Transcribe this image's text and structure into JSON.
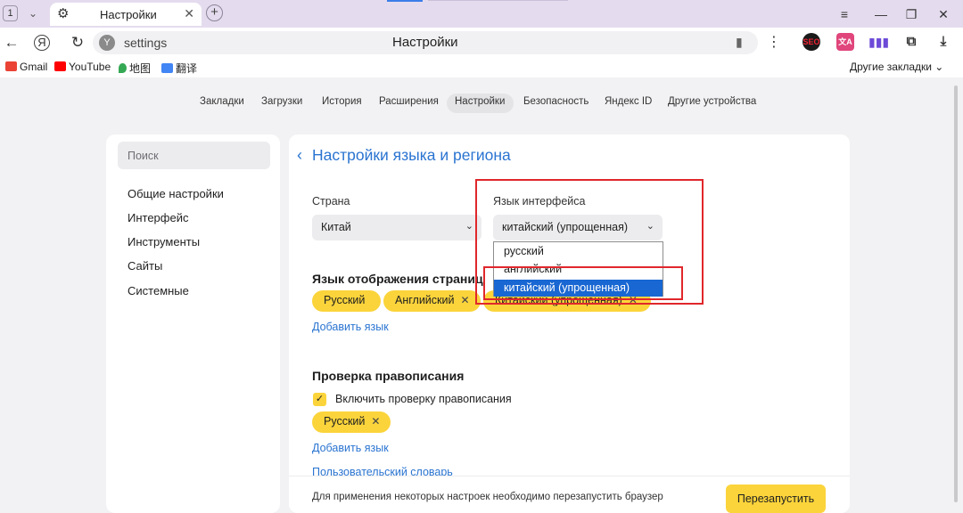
{
  "browser": {
    "tab_count": "1",
    "tab_title": "Настройки",
    "url": "settings",
    "page_title": "Настройки",
    "bookmarks": [
      {
        "label": "Gmail",
        "color": "#ea4335"
      },
      {
        "label": "YouTube",
        "color": "#ff0000"
      },
      {
        "label": "地图",
        "color": "#34a853"
      },
      {
        "label": "翻译",
        "color": "#4285f4"
      }
    ],
    "other_bookmarks": "Другие закладки"
  },
  "topnav": [
    "Закладки",
    "Загрузки",
    "История",
    "Расширения",
    "Настройки",
    "Безопасность",
    "Яндекс ID",
    "Другие устройства"
  ],
  "topnav_active_index": 4,
  "sidebar": {
    "search_placeholder": "Поиск",
    "items": [
      "Общие настройки",
      "Интерфейс",
      "Инструменты",
      "Сайты",
      "Системные"
    ]
  },
  "main": {
    "title": "Настройки языка и региона",
    "country": {
      "label": "Страна",
      "value": "Китай"
    },
    "ui_language": {
      "label": "Язык интерфейса",
      "value": "китайский (упрощенная)",
      "options": [
        "русский",
        "английский",
        "китайский (упрощенная)"
      ],
      "selected_index": 2
    },
    "page_languages": {
      "heading": "Язык отображения страниц",
      "chips": [
        "Русский",
        "Английский",
        "Китайский (упрощенная)"
      ],
      "add_link": "Добавить язык"
    },
    "spellcheck": {
      "heading": "Проверка правописания",
      "checkbox_label": "Включить проверку правописания",
      "checked": true,
      "chips": [
        "Русский"
      ],
      "add_link": "Добавить язык",
      "dictionary_link": "Пользовательский словарь"
    },
    "footer": {
      "text": "Для применения некоторых настроек необходимо перезапустить браузер",
      "button": "Перезапустить"
    }
  },
  "colors": {
    "accent_yellow": "#fbd43b",
    "link_blue": "#2a74d1",
    "annotation_red": "#e0272b",
    "selection_blue": "#1967d2"
  }
}
